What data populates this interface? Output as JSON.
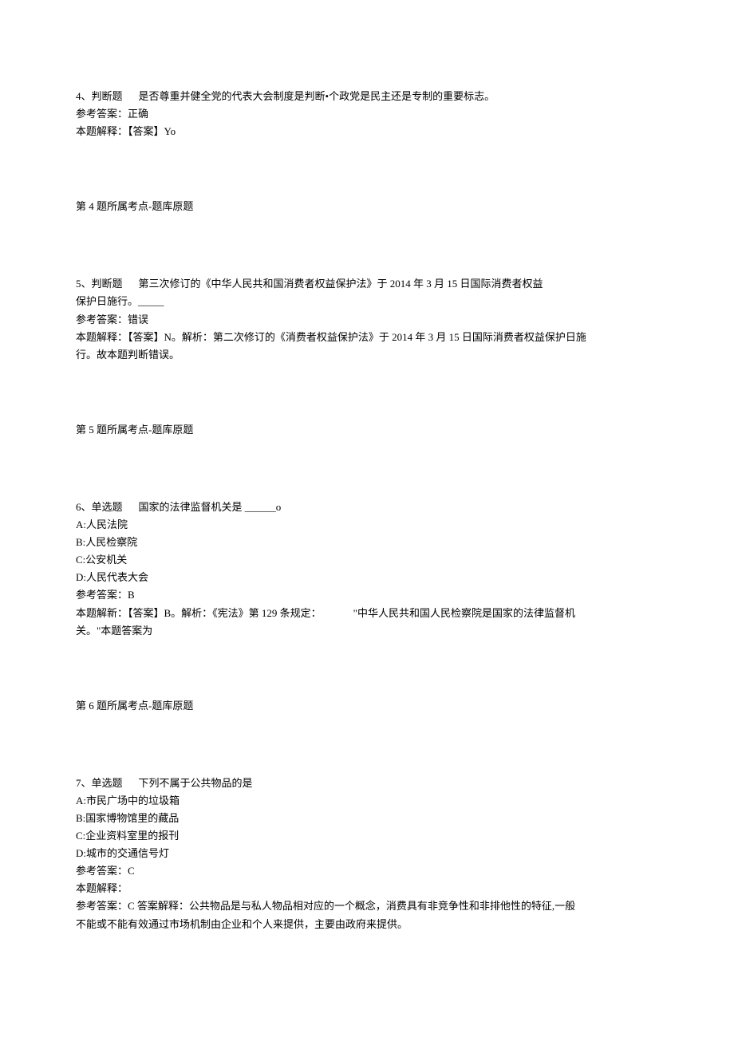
{
  "q4": {
    "header": "4、判断题",
    "text": "是否尊重并健全党的代表大会制度是判断•个政党是民主还是专制的重要标志。",
    "ref_label": "参考答案：正确",
    "explain": "本题解释：【答案】Yo",
    "category": "第 4 题所属考点-题库原题"
  },
  "q5": {
    "header": "5、判断题",
    "text1": "第三次修订的《中华人民共和国消费者权益保护法》于 2014 年 3 月 15 日国际消费者权益",
    "text2": "保护日施行。_____",
    "ref_label": "参考答案：错误",
    "explain1": "本题解释：【答案】N。解析：第二次修订的《消费者权益保护法》于 2014 年 3 月 15 日国际消费者权益保护日施",
    "explain2": "行。故本题判断错误。",
    "category": "第 5 题所属考点-题库原题"
  },
  "q6": {
    "header": "6、单选题",
    "text": "国家的法律监督机关是 ______o",
    "optA": "A:人民法院",
    "optB": "B:人民检察院",
    "optC": "C:公安机关",
    "optD": "D:人民代表大会",
    "ref_label": "参考答案：B",
    "explain1_left": "本题解新：【答案】B。解析：《宪法》第 129 条规定：",
    "explain1_right": "\"中华人民共和国人民检察院是国家的法律监督机",
    "explain2": "关。\"本题答案为",
    "category": "第 6 题所属考点-题库原题"
  },
  "q7": {
    "header": "7、单选题",
    "text": "下列不属于公共物品的是",
    "optA": "A:市民广场中的垃圾箱",
    "optB": "B:国家博物馆里的藏品",
    "optC": "C:企业资料室里的报刊",
    "optD": "D:城市的交通信号灯",
    "ref_label": "参考答案：C",
    "explain_label": "本题解释：",
    "explain1": "参考答案：C 答案解释：公共物品是与私人物品相对应的一个概念，消费具有非竞争性和非排他性的特征,一般",
    "explain2": "不能或不能有效通过市场机制由企业和个人来提供，主要由政府来提供。"
  }
}
